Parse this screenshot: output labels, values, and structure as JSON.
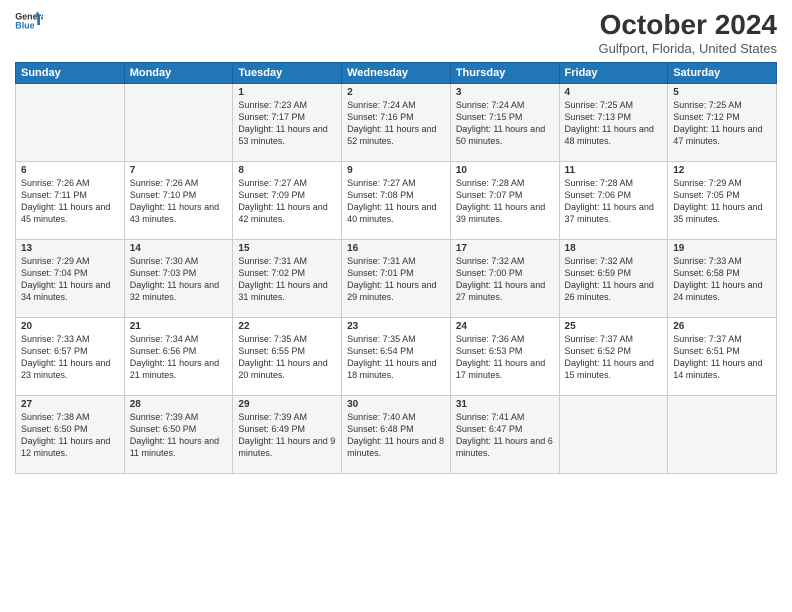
{
  "header": {
    "logo_line1": "General",
    "logo_line2": "Blue",
    "month_title": "October 2024",
    "location": "Gulfport, Florida, United States"
  },
  "days_of_week": [
    "Sunday",
    "Monday",
    "Tuesday",
    "Wednesday",
    "Thursday",
    "Friday",
    "Saturday"
  ],
  "weeks": [
    [
      {
        "day": "",
        "sunrise": "",
        "sunset": "",
        "daylight": ""
      },
      {
        "day": "",
        "sunrise": "",
        "sunset": "",
        "daylight": ""
      },
      {
        "day": "1",
        "sunrise": "Sunrise: 7:23 AM",
        "sunset": "Sunset: 7:17 PM",
        "daylight": "Daylight: 11 hours and 53 minutes."
      },
      {
        "day": "2",
        "sunrise": "Sunrise: 7:24 AM",
        "sunset": "Sunset: 7:16 PM",
        "daylight": "Daylight: 11 hours and 52 minutes."
      },
      {
        "day": "3",
        "sunrise": "Sunrise: 7:24 AM",
        "sunset": "Sunset: 7:15 PM",
        "daylight": "Daylight: 11 hours and 50 minutes."
      },
      {
        "day": "4",
        "sunrise": "Sunrise: 7:25 AM",
        "sunset": "Sunset: 7:13 PM",
        "daylight": "Daylight: 11 hours and 48 minutes."
      },
      {
        "day": "5",
        "sunrise": "Sunrise: 7:25 AM",
        "sunset": "Sunset: 7:12 PM",
        "daylight": "Daylight: 11 hours and 47 minutes."
      }
    ],
    [
      {
        "day": "6",
        "sunrise": "Sunrise: 7:26 AM",
        "sunset": "Sunset: 7:11 PM",
        "daylight": "Daylight: 11 hours and 45 minutes."
      },
      {
        "day": "7",
        "sunrise": "Sunrise: 7:26 AM",
        "sunset": "Sunset: 7:10 PM",
        "daylight": "Daylight: 11 hours and 43 minutes."
      },
      {
        "day": "8",
        "sunrise": "Sunrise: 7:27 AM",
        "sunset": "Sunset: 7:09 PM",
        "daylight": "Daylight: 11 hours and 42 minutes."
      },
      {
        "day": "9",
        "sunrise": "Sunrise: 7:27 AM",
        "sunset": "Sunset: 7:08 PM",
        "daylight": "Daylight: 11 hours and 40 minutes."
      },
      {
        "day": "10",
        "sunrise": "Sunrise: 7:28 AM",
        "sunset": "Sunset: 7:07 PM",
        "daylight": "Daylight: 11 hours and 39 minutes."
      },
      {
        "day": "11",
        "sunrise": "Sunrise: 7:28 AM",
        "sunset": "Sunset: 7:06 PM",
        "daylight": "Daylight: 11 hours and 37 minutes."
      },
      {
        "day": "12",
        "sunrise": "Sunrise: 7:29 AM",
        "sunset": "Sunset: 7:05 PM",
        "daylight": "Daylight: 11 hours and 35 minutes."
      }
    ],
    [
      {
        "day": "13",
        "sunrise": "Sunrise: 7:29 AM",
        "sunset": "Sunset: 7:04 PM",
        "daylight": "Daylight: 11 hours and 34 minutes."
      },
      {
        "day": "14",
        "sunrise": "Sunrise: 7:30 AM",
        "sunset": "Sunset: 7:03 PM",
        "daylight": "Daylight: 11 hours and 32 minutes."
      },
      {
        "day": "15",
        "sunrise": "Sunrise: 7:31 AM",
        "sunset": "Sunset: 7:02 PM",
        "daylight": "Daylight: 11 hours and 31 minutes."
      },
      {
        "day": "16",
        "sunrise": "Sunrise: 7:31 AM",
        "sunset": "Sunset: 7:01 PM",
        "daylight": "Daylight: 11 hours and 29 minutes."
      },
      {
        "day": "17",
        "sunrise": "Sunrise: 7:32 AM",
        "sunset": "Sunset: 7:00 PM",
        "daylight": "Daylight: 11 hours and 27 minutes."
      },
      {
        "day": "18",
        "sunrise": "Sunrise: 7:32 AM",
        "sunset": "Sunset: 6:59 PM",
        "daylight": "Daylight: 11 hours and 26 minutes."
      },
      {
        "day": "19",
        "sunrise": "Sunrise: 7:33 AM",
        "sunset": "Sunset: 6:58 PM",
        "daylight": "Daylight: 11 hours and 24 minutes."
      }
    ],
    [
      {
        "day": "20",
        "sunrise": "Sunrise: 7:33 AM",
        "sunset": "Sunset: 6:57 PM",
        "daylight": "Daylight: 11 hours and 23 minutes."
      },
      {
        "day": "21",
        "sunrise": "Sunrise: 7:34 AM",
        "sunset": "Sunset: 6:56 PM",
        "daylight": "Daylight: 11 hours and 21 minutes."
      },
      {
        "day": "22",
        "sunrise": "Sunrise: 7:35 AM",
        "sunset": "Sunset: 6:55 PM",
        "daylight": "Daylight: 11 hours and 20 minutes."
      },
      {
        "day": "23",
        "sunrise": "Sunrise: 7:35 AM",
        "sunset": "Sunset: 6:54 PM",
        "daylight": "Daylight: 11 hours and 18 minutes."
      },
      {
        "day": "24",
        "sunrise": "Sunrise: 7:36 AM",
        "sunset": "Sunset: 6:53 PM",
        "daylight": "Daylight: 11 hours and 17 minutes."
      },
      {
        "day": "25",
        "sunrise": "Sunrise: 7:37 AM",
        "sunset": "Sunset: 6:52 PM",
        "daylight": "Daylight: 11 hours and 15 minutes."
      },
      {
        "day": "26",
        "sunrise": "Sunrise: 7:37 AM",
        "sunset": "Sunset: 6:51 PM",
        "daylight": "Daylight: 11 hours and 14 minutes."
      }
    ],
    [
      {
        "day": "27",
        "sunrise": "Sunrise: 7:38 AM",
        "sunset": "Sunset: 6:50 PM",
        "daylight": "Daylight: 11 hours and 12 minutes."
      },
      {
        "day": "28",
        "sunrise": "Sunrise: 7:39 AM",
        "sunset": "Sunset: 6:50 PM",
        "daylight": "Daylight: 11 hours and 11 minutes."
      },
      {
        "day": "29",
        "sunrise": "Sunrise: 7:39 AM",
        "sunset": "Sunset: 6:49 PM",
        "daylight": "Daylight: 11 hours and 9 minutes."
      },
      {
        "day": "30",
        "sunrise": "Sunrise: 7:40 AM",
        "sunset": "Sunset: 6:48 PM",
        "daylight": "Daylight: 11 hours and 8 minutes."
      },
      {
        "day": "31",
        "sunrise": "Sunrise: 7:41 AM",
        "sunset": "Sunset: 6:47 PM",
        "daylight": "Daylight: 11 hours and 6 minutes."
      },
      {
        "day": "",
        "sunrise": "",
        "sunset": "",
        "daylight": ""
      },
      {
        "day": "",
        "sunrise": "",
        "sunset": "",
        "daylight": ""
      }
    ]
  ]
}
